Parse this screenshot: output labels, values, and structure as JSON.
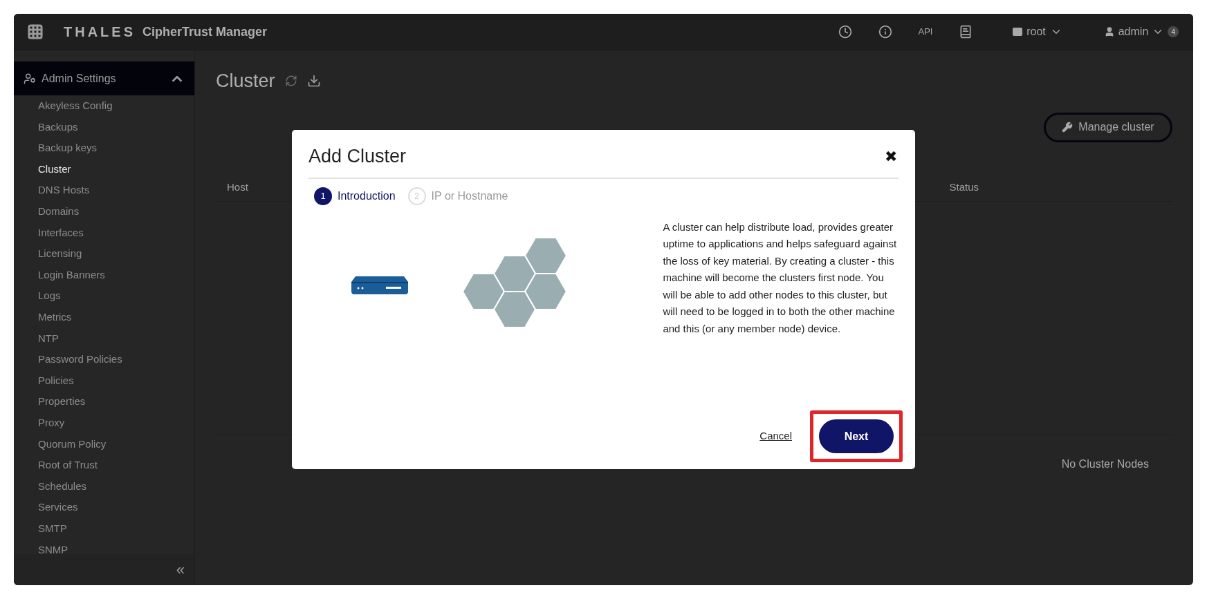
{
  "top_bar": {
    "brand": "THALES",
    "product": "CipherTrust Manager",
    "api_label": "API",
    "domain": "root",
    "user": "admin",
    "user_badge": "4"
  },
  "sidebar": {
    "section": {
      "label": "Admin Settings",
      "expanded": true
    },
    "items": [
      {
        "label": "Akeyless Config",
        "selected": false
      },
      {
        "label": "Backups",
        "selected": false
      },
      {
        "label": "Backup keys",
        "selected": false
      },
      {
        "label": "Cluster",
        "selected": true
      },
      {
        "label": "DNS Hosts",
        "selected": false
      },
      {
        "label": "Domains",
        "selected": false
      },
      {
        "label": "Interfaces",
        "selected": false
      },
      {
        "label": "Licensing",
        "selected": false
      },
      {
        "label": "Login Banners",
        "selected": false
      },
      {
        "label": "Logs",
        "selected": false
      },
      {
        "label": "Metrics",
        "selected": false
      },
      {
        "label": "NTP",
        "selected": false
      },
      {
        "label": "Password Policies",
        "selected": false
      },
      {
        "label": "Policies",
        "selected": false
      },
      {
        "label": "Properties",
        "selected": false
      },
      {
        "label": "Proxy",
        "selected": false
      },
      {
        "label": "Quorum Policy",
        "selected": false
      },
      {
        "label": "Root of Trust",
        "selected": false
      },
      {
        "label": "Schedules",
        "selected": false
      },
      {
        "label": "Services",
        "selected": false
      },
      {
        "label": "SMTP",
        "selected": false
      },
      {
        "label": "SNMP",
        "selected": false
      }
    ],
    "collapse": "«"
  },
  "page": {
    "title": "Cluster",
    "manage_button": "Manage cluster",
    "table": {
      "columns": [
        "Host",
        "Status"
      ],
      "empty_message": "No Cluster Nodes"
    }
  },
  "dialog": {
    "title": "Add Cluster",
    "close": "✖",
    "steps": [
      {
        "number": "1",
        "label": "Introduction",
        "selected": true
      },
      {
        "number": "2",
        "label": "IP or Hostname",
        "selected": false
      }
    ],
    "description": "A cluster can help distribute load, provides greater uptime to applications and helps safeguard against the loss of key material. By creating a cluster - this machine will become the clusters first node. You will be able to add other nodes to this cluster, but will need to be logged in to both the other machine and this (or any member node) device.",
    "cancel": "Cancel",
    "next": {
      "label": "Next",
      "highlighted": true
    }
  }
}
